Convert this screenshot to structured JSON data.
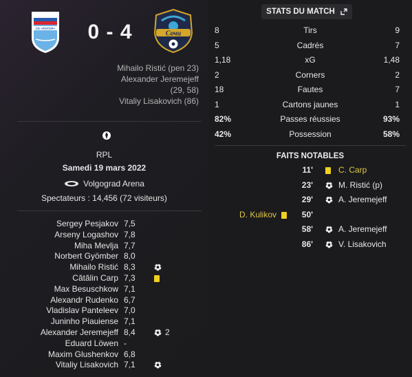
{
  "match": {
    "score": "0 - 4",
    "home_team_crest_label": "СК «РОТОР»",
    "away_team_crest_label": "Сочи",
    "scorers": [
      "Mihailo Ristić (pen 23)",
      "Alexander Jeremejeff",
      "(29, 58)",
      "Vitaliy Lisakovich (86)"
    ],
    "competition": "RPL",
    "date": "Samedi 19 mars 2022",
    "stadium": "Volgograd Arena",
    "attendance": "Spectateurs : 14,456 (72 visiteurs)"
  },
  "players": [
    {
      "name": "Sergey Pesjakov",
      "rating": "7,5",
      "icon": "",
      "extra": ""
    },
    {
      "name": "Arseny Logashov",
      "rating": "7,8",
      "icon": "",
      "extra": ""
    },
    {
      "name": "Miha Mevlja",
      "rating": "7,7",
      "icon": "",
      "extra": ""
    },
    {
      "name": "Norbert Gyömber",
      "rating": "8,0",
      "icon": "",
      "extra": ""
    },
    {
      "name": "Mihailo Ristić",
      "rating": "8,3",
      "icon": "ball",
      "extra": ""
    },
    {
      "name": "Cătălin Carp",
      "rating": "7,3",
      "icon": "yellow-card",
      "extra": ""
    },
    {
      "name": "Max Besuschkow",
      "rating": "7,1",
      "icon": "",
      "extra": ""
    },
    {
      "name": "Alexandr Rudenko",
      "rating": "6,7",
      "icon": "",
      "extra": ""
    },
    {
      "name": "Vladislav Panteleev",
      "rating": "7,0",
      "icon": "",
      "extra": ""
    },
    {
      "name": "Juninho Piauiense",
      "rating": "7,1",
      "icon": "",
      "extra": ""
    },
    {
      "name": "Alexander Jeremejeff",
      "rating": "8,4",
      "icon": "ball",
      "extra": "2"
    },
    {
      "name": "Eduard Löwen",
      "rating": "-",
      "icon": "",
      "extra": ""
    },
    {
      "name": "Maxim Glushenkov",
      "rating": "6,8",
      "icon": "",
      "extra": ""
    },
    {
      "name": "Vitaliy Lisakovich",
      "rating": "7,1",
      "icon": "ball",
      "extra": ""
    }
  ],
  "stats_title": "STATS DU MATCH",
  "stats": [
    {
      "home": "8",
      "label": "Tirs",
      "away": "9",
      "bold": false
    },
    {
      "home": "5",
      "label": "Cadrés",
      "away": "7",
      "bold": false
    },
    {
      "home": "1,18",
      "label": "xG",
      "away": "1,48",
      "bold": false
    },
    {
      "home": "2",
      "label": "Corners",
      "away": "2",
      "bold": false
    },
    {
      "home": "18",
      "label": "Fautes",
      "away": "7",
      "bold": false
    },
    {
      "home": "1",
      "label": "Cartons jaunes",
      "away": "1",
      "bold": false
    },
    {
      "home": "82%",
      "label": "Passes réussies",
      "away": "93%",
      "bold": true
    },
    {
      "home": "42%",
      "label": "Possession",
      "away": "58%",
      "bold": true
    }
  ],
  "faits_title": "FAITS NOTABLES",
  "events": [
    {
      "minute": "11'",
      "icon": "yellow-card",
      "player": "C. Carp",
      "home": "",
      "home_icon": ""
    },
    {
      "minute": "23'",
      "icon": "ball",
      "player": "M. Ristić (p)",
      "home": "",
      "home_icon": ""
    },
    {
      "minute": "29'",
      "icon": "ball",
      "player": "A. Jeremejeff",
      "home": "",
      "home_icon": ""
    },
    {
      "minute": "50'",
      "icon": "",
      "player": "",
      "home": "D. Kulikov",
      "home_icon": "yellow-card"
    },
    {
      "minute": "58'",
      "icon": "ball",
      "player": "A. Jeremejeff",
      "home": "",
      "home_icon": ""
    },
    {
      "minute": "86'",
      "icon": "ball",
      "player": "V. Lisakovich",
      "home": "",
      "home_icon": ""
    }
  ],
  "colors": {
    "background": "#1b1b1d",
    "yellow_card": "#f0d020",
    "highlight_text": "#e0c84a",
    "rotor_blue": "#5ba8e0",
    "sochi_navy": "#1f2a4a"
  }
}
